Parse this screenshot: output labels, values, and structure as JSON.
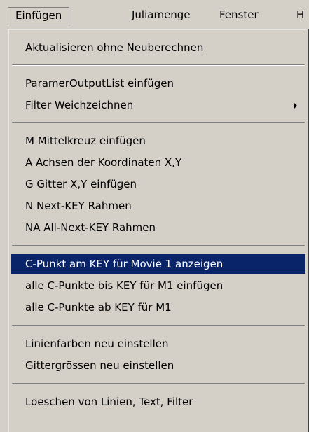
{
  "menubar": {
    "items": [
      {
        "label": "Einfügen",
        "active": true
      },
      {
        "label": "Juliamenge"
      },
      {
        "label": "Fenster"
      },
      {
        "label": "H"
      }
    ]
  },
  "menu": {
    "items": [
      {
        "label": "Aktualisieren ohne Neuberechnen"
      },
      {
        "label": "ParamerOutputList einfügen"
      },
      {
        "label": "Filter Weichzeichnen",
        "submenu": true
      },
      {
        "label": "M Mittelkreuz einfügen"
      },
      {
        "label": "A Achsen der Koordinaten X,Y"
      },
      {
        "label": "G Gitter X,Y einfügen"
      },
      {
        "label": "N Next-KEY Rahmen"
      },
      {
        "label": "NA All-Next-KEY Rahmen"
      },
      {
        "label": "C-Punkt am KEY für Movie 1 anzeigen",
        "highlighted": true
      },
      {
        "label": "alle C-Punkte bis KEY für M1 einfügen"
      },
      {
        "label": "alle C-Punkte ab KEY für M1"
      },
      {
        "label": "Linienfarben neu einstellen"
      },
      {
        "label": "Gittergrössen neu einstellen"
      },
      {
        "label": "Loeschen von Linien, Text, Filter"
      }
    ]
  },
  "colors": {
    "menu_bg": "#d4d0c8",
    "highlight_bg": "#0a246a",
    "highlight_text": "#ffffff"
  },
  "icons": [
    "submenu-arrow-icon"
  ]
}
